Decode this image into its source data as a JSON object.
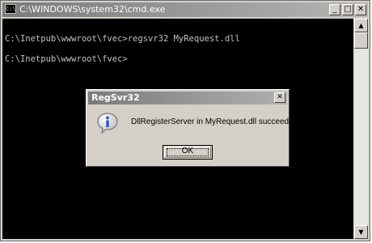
{
  "window": {
    "title": "C:\\WINDOWS\\system32\\cmd.exe",
    "title_icon_text": "C:\\",
    "buttons": {
      "minimize": "_",
      "maximize": "□",
      "close": "✕"
    }
  },
  "console": {
    "lines": [
      "C:\\Inetpub\\wwwroot\\fvec>regsvr32 MyRequest.dll",
      "C:\\Inetpub\\wwwroot\\fvec>"
    ]
  },
  "scrollbar": {
    "up_arrow": "▲",
    "down_arrow": "▼"
  },
  "dialog": {
    "title": "RegSvr32",
    "close": "✕",
    "message": "DllRegisterServer in MyRequest.dll succeeded.",
    "ok_label": "OK",
    "icon": "info-icon"
  }
}
